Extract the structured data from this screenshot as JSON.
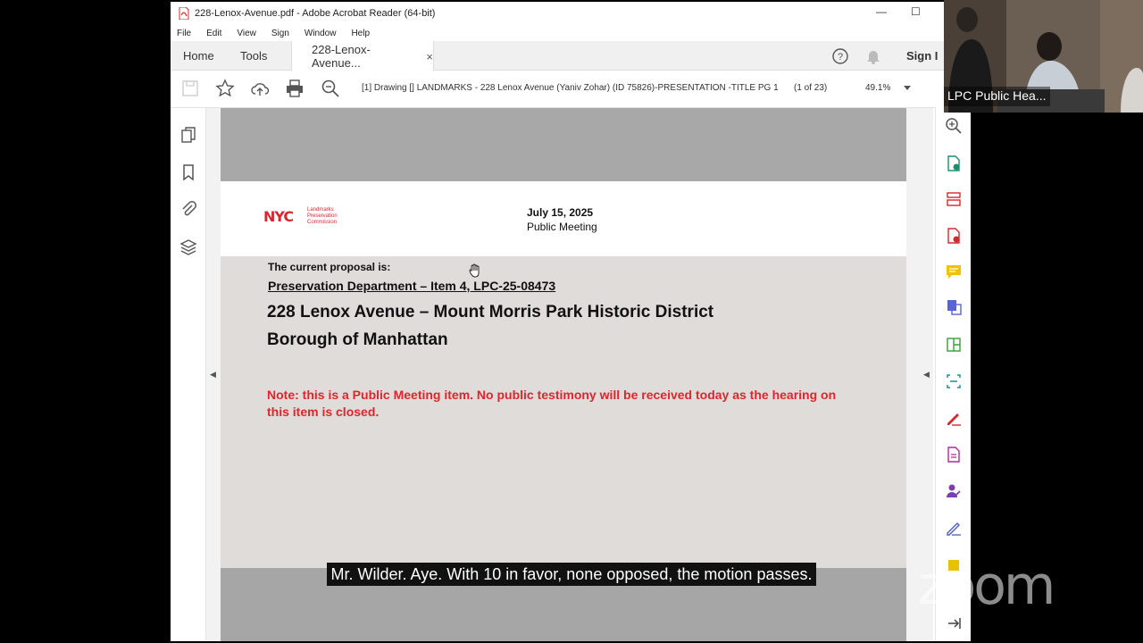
{
  "window": {
    "title": "228-Lenox-Avenue.pdf - Adobe Acrobat Reader (64-bit)",
    "minimize": "—",
    "maximize": "☐"
  },
  "menu": [
    "File",
    "Edit",
    "View",
    "Sign",
    "Window",
    "Help"
  ],
  "tabs": {
    "home": "Home",
    "tools": "Tools",
    "document": "228-Lenox-Avenue...",
    "close": "×",
    "sign_in": "Sign I"
  },
  "toolbar": {
    "doc_path": "[1] Drawing [] LANDMARKS - 228 Lenox Avenue (Yaniv Zohar) (ID 75826)-PRESENTATION -TITLE PG 1",
    "page_count": "(1 of 23)",
    "zoom": "49.1%"
  },
  "page": {
    "logo_text": "NYC",
    "logo_sub": "Landmarks Preservation Commission",
    "date": "July 15, 2025",
    "meeting": "Public Meeting",
    "current_proposal": "The current proposal is:",
    "department": "Preservation Department – Item 4, LPC-25-08473",
    "address": "228 Lenox Avenue – Mount Morris Park Historic District",
    "borough": "Borough of Manhattan",
    "note": "Note: this is a Public Meeting item. No public testimony will be received today as the hearing on this item is closed."
  },
  "video": {
    "label": "LPC Public Hea..."
  },
  "zoom_logo": "zoom",
  "caption": "Mr. Wilder. Aye. With 10 in favor, none opposed, the motion passes."
}
